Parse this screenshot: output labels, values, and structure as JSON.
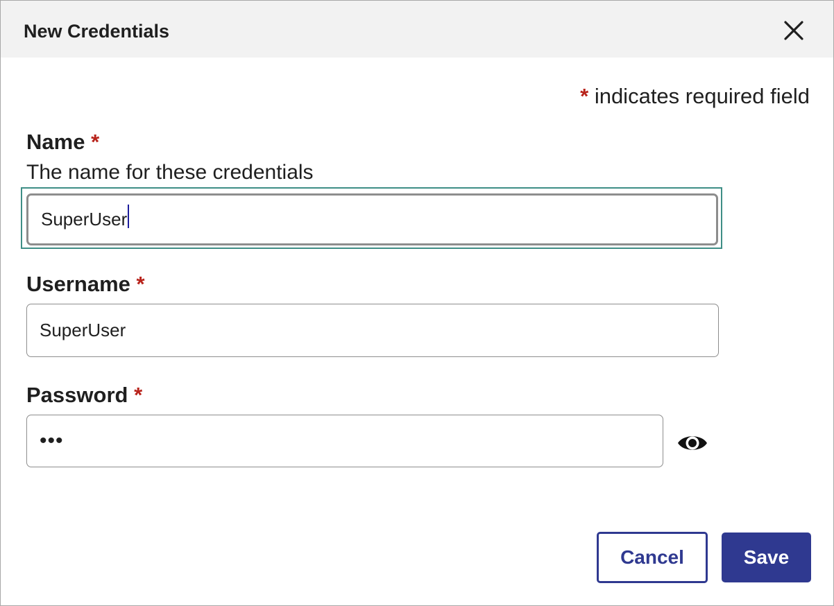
{
  "dialog": {
    "title": "New Credentials"
  },
  "required_note": {
    "star": "*",
    "text": " indicates required field"
  },
  "fields": {
    "name": {
      "label": "Name",
      "star": "*",
      "help": "The name for these credentials",
      "value": "SuperUser"
    },
    "username": {
      "label": "Username",
      "star": "*",
      "value": "SuperUser"
    },
    "password": {
      "label": "Password",
      "star": "*",
      "value": "•••"
    }
  },
  "buttons": {
    "cancel": "Cancel",
    "save": "Save"
  },
  "icons": {
    "close": "close-icon",
    "show_password": "eye-icon"
  },
  "colors": {
    "primary": "#2f3990",
    "required": "#b8231b",
    "focus": "#3e8e86",
    "header_bg": "#f2f2f2"
  }
}
